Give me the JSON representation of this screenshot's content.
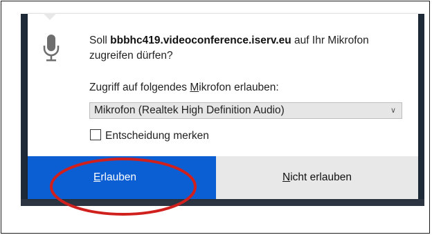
{
  "dialog": {
    "message_prefix": "Soll ",
    "host": "bbbhc419.videoconference.iserv.eu",
    "message_suffix": " auf Ihr Mikrofon zugreifen dürfen?",
    "access_label_before": "Zugriff auf folgendes ",
    "access_label_mnemonic": "M",
    "access_label_after": "ikrofon erlauben:",
    "device_selected": "Mikrofon (Realtek High Definition Audio)",
    "remember_label": "Entscheidung merken",
    "remember_checked": false,
    "allow_label": "Erlauben",
    "deny_label": "Nicht erlauben"
  },
  "icons": {
    "microphone": "microphone-icon",
    "dropdown": "chevron-down-icon"
  },
  "colors": {
    "allow_button": "#0b5fd3",
    "deny_button": "#e8e8e8",
    "annotation_circle": "#d0201e",
    "background_page": "#1e2a38"
  }
}
